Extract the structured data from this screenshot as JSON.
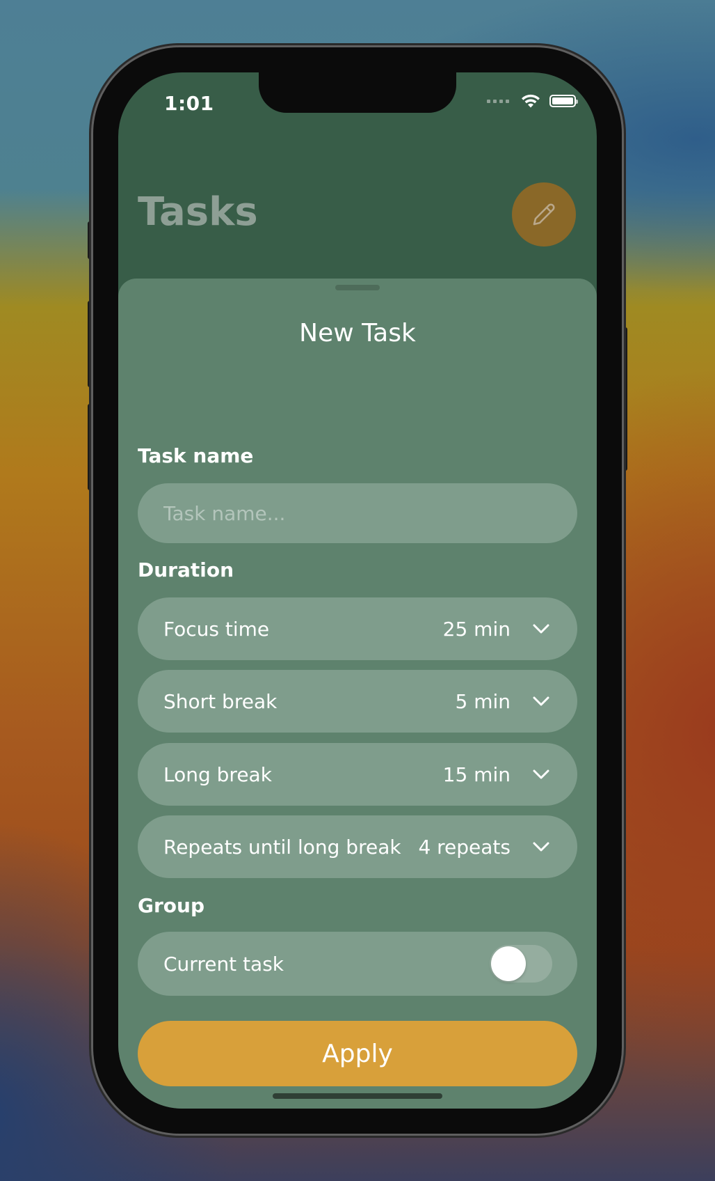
{
  "status_bar": {
    "time": "1:01"
  },
  "header": {
    "title": "Tasks",
    "edit_icon": "pencil-icon"
  },
  "sheet": {
    "title": "New Task",
    "task_name": {
      "label": "Task name",
      "placeholder": "Task name...",
      "value": ""
    },
    "duration": {
      "label": "Duration",
      "rows": [
        {
          "label": "Focus time",
          "value": "25 min"
        },
        {
          "label": "Short break",
          "value": "5 min"
        },
        {
          "label": "Long break",
          "value": "15 min"
        },
        {
          "label": "Repeats until long break",
          "value": "4 repeats"
        }
      ]
    },
    "group": {
      "label": "Group",
      "current_task_label": "Current task",
      "current_task_enabled": false
    },
    "apply_label": "Apply"
  },
  "colors": {
    "background": "#385d48",
    "sheet": "#5e826d",
    "field": "#7f9d8c",
    "accent": "#d8a03a",
    "fab": "#8a6828"
  }
}
